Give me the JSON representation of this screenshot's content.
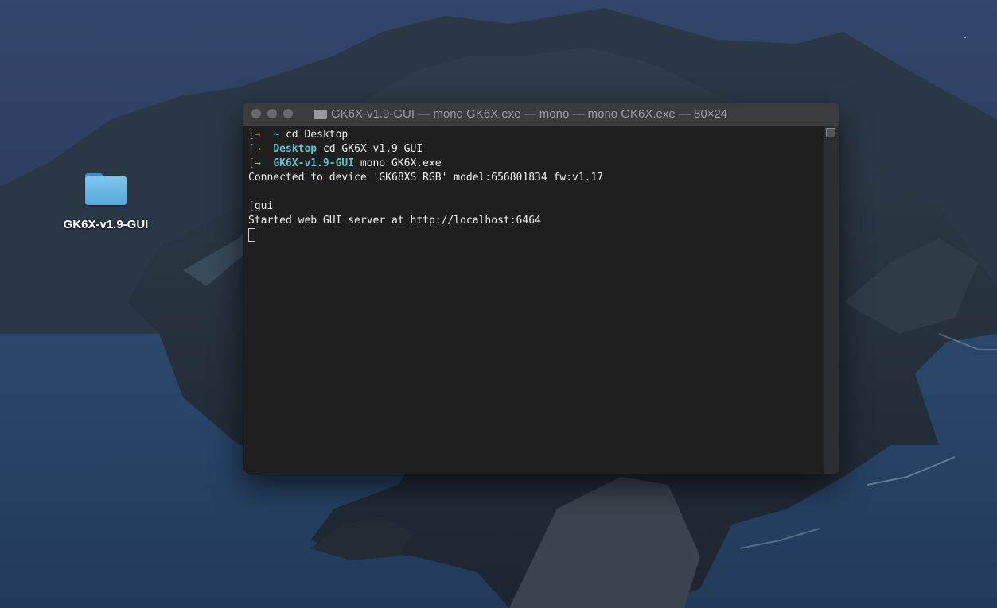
{
  "desktop": {
    "folder_label": "GK6X-v1.9-GUI",
    "folder_icon": "folder-icon"
  },
  "terminal": {
    "title": "GK6X-v1.9-GUI — mono GK6X.exe — mono — mono GK6X.exe — 80×24",
    "title_icon": "folder-icon",
    "colors": {
      "background": "#1f1f1f",
      "prompt_arrow_ok": "#5fd57f",
      "prompt_arrow_err": "#e5483d",
      "directory": "#5ec3c9",
      "text": "#f0f0f0"
    },
    "prompts": [
      {
        "dir": "~",
        "cmd": "cd Desktop"
      },
      {
        "dir": "Desktop",
        "cmd": "cd GK6X-v1.9-GUI"
      },
      {
        "dir": "GK6X-v1.9-GUI",
        "cmd": "mono GK6X.exe"
      }
    ],
    "output": [
      "Connected to device 'GK68XS RGB' model:656801834 fw:v1.17",
      "gui",
      "Started web GUI server at http://localhost:6464"
    ]
  }
}
